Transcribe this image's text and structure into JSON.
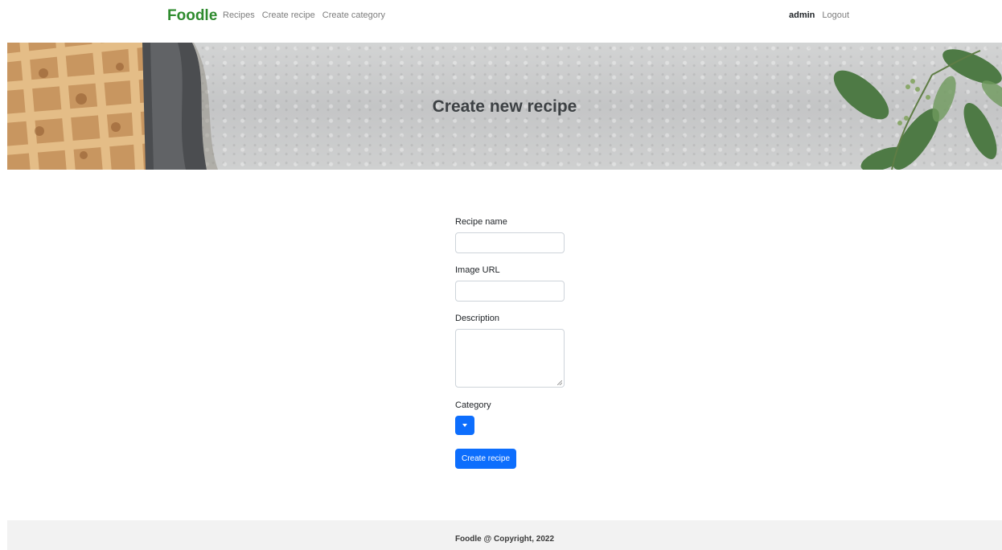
{
  "navbar": {
    "brand": "Foodle",
    "links": [
      "Recipes",
      "Create recipe",
      "Create category"
    ],
    "user": "admin",
    "logout": "Logout",
    "brand_color": "#2e8b2e"
  },
  "hero": {
    "title": "Create new recipe"
  },
  "form": {
    "name_label": "Recipe name",
    "name_value": "",
    "image_label": "Image URL",
    "image_value": "",
    "description_label": "Description",
    "description_value": "",
    "category_label": "Category",
    "category_icon": "chevron-down-icon",
    "submit_label": "Create recipe",
    "accent_color": "#0d6efd"
  },
  "footer": {
    "text": "Foodle @ Copyright, 2022"
  }
}
